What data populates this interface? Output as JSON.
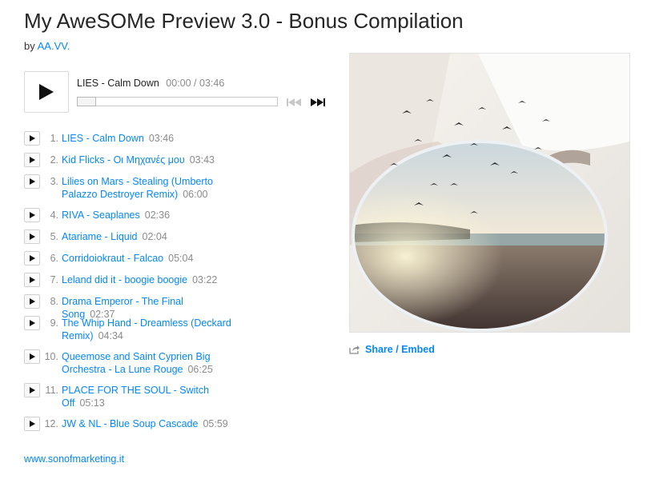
{
  "album": {
    "title": "My AweSOMe Preview 3.0 - Bonus Compilation",
    "by_prefix": "by",
    "artist": "AA.VV."
  },
  "player": {
    "current_track": "LIES - Calm Down",
    "time": "00:00 / 03:46",
    "progress_fraction": 0
  },
  "tracks": [
    {
      "num": "1.",
      "title": "LIES - Calm Down",
      "duration": "03:46"
    },
    {
      "num": "2.",
      "title": "Kid Flicks - Οι Μηχανές μου",
      "duration": "03:43"
    },
    {
      "num": "3.",
      "title": "Lilies on Mars - Stealing (Umberto Palazzo Destroyer Remix)",
      "duration": "06:00"
    },
    {
      "num": "4.",
      "title": "RIVA - Seaplanes",
      "duration": "02:36"
    },
    {
      "num": "5.",
      "title": "Atariame - Liquid",
      "duration": "02:04"
    },
    {
      "num": "6.",
      "title": "Corridoiokraut - Falcao",
      "duration": "05:04"
    },
    {
      "num": "7.",
      "title": "Leland did it - boogie boogie",
      "duration": "03:22"
    },
    {
      "num": "8.",
      "title": "Drama Emperor - The Final Song",
      "duration": "02:37"
    },
    {
      "num": "9.",
      "title": "The Whip Hand - Dreamless (Deckard Remix)",
      "duration": "04:34"
    },
    {
      "num": "10.",
      "title": "Queemose and Saint Cyprien Big Orchestra - La Lune Rouge",
      "duration": "06:25"
    },
    {
      "num": "11.",
      "title": "PLACE FOR THE SOUL - Switch Off",
      "duration": "05:13"
    },
    {
      "num": "12.",
      "title": "JW & NL - Blue Soup Cascade",
      "duration": "05:59"
    }
  ],
  "share": {
    "label": "Share / Embed",
    "icon": "share-icon"
  },
  "footer": {
    "link": "www.sonofmarketing.it"
  },
  "colors": {
    "link": "#0687f5",
    "muted": "#8b8b8b",
    "title": "#262626"
  }
}
